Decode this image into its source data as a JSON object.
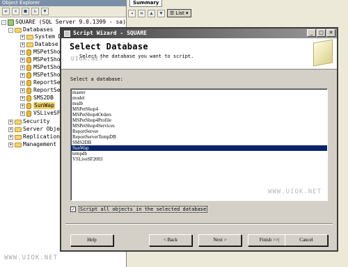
{
  "object_explorer": {
    "title": "Object Explorer",
    "tree": [
      {
        "label": "SQUARE (SQL Server 9.0.1399 - sa)",
        "icon": "server-icon",
        "expander": "-"
      },
      {
        "label": "Databases",
        "icon": "folder-icon",
        "expander": "-"
      },
      {
        "label": "System D",
        "icon": "folder-icon",
        "expander": "+"
      },
      {
        "label": "Databse",
        "icon": "folder-icon",
        "expander": "+"
      },
      {
        "label": "MSPetSho",
        "icon": "db-icon",
        "expander": "+"
      },
      {
        "label": "MSPetSho",
        "icon": "db-icon",
        "expander": "+"
      },
      {
        "label": "MSPetSho",
        "icon": "db-icon",
        "expander": "+"
      },
      {
        "label": "MSPetSho",
        "icon": "db-icon",
        "expander": "+"
      },
      {
        "label": "ReportSe",
        "icon": "db-icon",
        "expander": "+"
      },
      {
        "label": "ReportSe",
        "icon": "db-icon",
        "expander": "+"
      },
      {
        "label": "SMS2DB",
        "icon": "db-icon",
        "expander": "+"
      },
      {
        "label": "SunWap",
        "icon": "db-icon",
        "expander": "+"
      },
      {
        "label": "VSLiveSF",
        "icon": "db-icon",
        "expander": "+"
      },
      {
        "label": "Security",
        "icon": "folder-icon",
        "expander": "+"
      },
      {
        "label": "Server Obje",
        "icon": "folder-icon",
        "expander": "+"
      },
      {
        "label": "Replication",
        "icon": "folder-icon",
        "expander": "+"
      },
      {
        "label": "Management",
        "icon": "folder-icon",
        "expander": "+"
      }
    ]
  },
  "summary": {
    "tab_label": "Summary",
    "list_button": "List"
  },
  "wizard": {
    "title": "Script Wizard - SQUARE",
    "header_title": "Select Database",
    "header_subtitle": "Select the database you want to script.",
    "select_label": "Select a database:",
    "databases": [
      "master",
      "model",
      "msdb",
      "MSPetShop4",
      "MSPetShop4Orders",
      "MSPetShop4Profile",
      "MSPetShop4Services",
      "ReportServer",
      "ReportServerTempDB",
      "SMS2DB",
      "SunWap",
      "tempdb",
      "VSLiveSF2003"
    ],
    "selected_database": "SunWap",
    "script_all_checked": true,
    "script_all_label": "Script all objects in the selected database",
    "buttons": {
      "help": "Help",
      "back": "< Back",
      "next": "Next >",
      "finish": "Finish >>|",
      "cancel": "Cancel"
    }
  },
  "watermarks": {
    "top": "UIOK.NET",
    "list": "WWW.UIOK.NET",
    "bottom": "WWW.UIOK.NET"
  },
  "colors": {
    "selection": "#0a246a",
    "dialog_face": "#d4d0c8",
    "highlight_node": "#f1d36b"
  }
}
